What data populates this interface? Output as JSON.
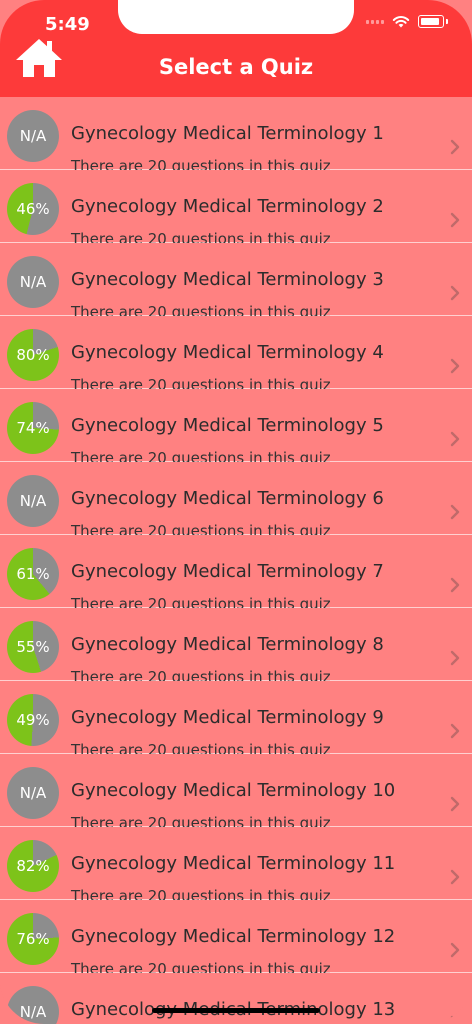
{
  "status_bar": {
    "time": "5:49"
  },
  "header": {
    "title": "Select a Quiz"
  },
  "colors": {
    "header": "#fd3a3a",
    "row": "#ff8181",
    "pie_green": "#7dc31a",
    "pie_gray": "#8d8d8d"
  },
  "quizzes": [
    {
      "title": "Gynecology Medical Terminology 1",
      "subtitle": "There are 20 questions in this quiz",
      "score": "N/A",
      "percent": null
    },
    {
      "title": "Gynecology Medical Terminology 2",
      "subtitle": "There are 20 questions in this quiz",
      "score": "46%",
      "percent": 46
    },
    {
      "title": "Gynecology Medical Terminology 3",
      "subtitle": "There are 20 questions in this quiz",
      "score": "N/A",
      "percent": null
    },
    {
      "title": "Gynecology Medical Terminology 4",
      "subtitle": "There are 20 questions in this quiz",
      "score": "80%",
      "percent": 80
    },
    {
      "title": "Gynecology Medical Terminology 5",
      "subtitle": "There are 20 questions in this quiz",
      "score": "74%",
      "percent": 74
    },
    {
      "title": "Gynecology Medical Terminology 6",
      "subtitle": "There are 20 questions in this quiz",
      "score": "N/A",
      "percent": null
    },
    {
      "title": "Gynecology Medical Terminology 7",
      "subtitle": "There are 20 questions in this quiz",
      "score": "61%",
      "percent": 61
    },
    {
      "title": "Gynecology Medical Terminology 8",
      "subtitle": "There are 20 questions in this quiz",
      "score": "55%",
      "percent": 55
    },
    {
      "title": "Gynecology Medical Terminology 9",
      "subtitle": "There are 20 questions in this quiz",
      "score": "49%",
      "percent": 49
    },
    {
      "title": "Gynecology Medical Terminology 10",
      "subtitle": "There are 20 questions in this quiz",
      "score": "N/A",
      "percent": null
    },
    {
      "title": "Gynecology Medical Terminology 11",
      "subtitle": "There are 20 questions in this quiz",
      "score": "82%",
      "percent": 82
    },
    {
      "title": "Gynecology Medical Terminology 12",
      "subtitle": "There are 20 questions in this quiz",
      "score": "76%",
      "percent": 76
    },
    {
      "title": "Gynecology Medical Terminology 13",
      "subtitle": "",
      "score": "N/A",
      "percent": null
    }
  ]
}
